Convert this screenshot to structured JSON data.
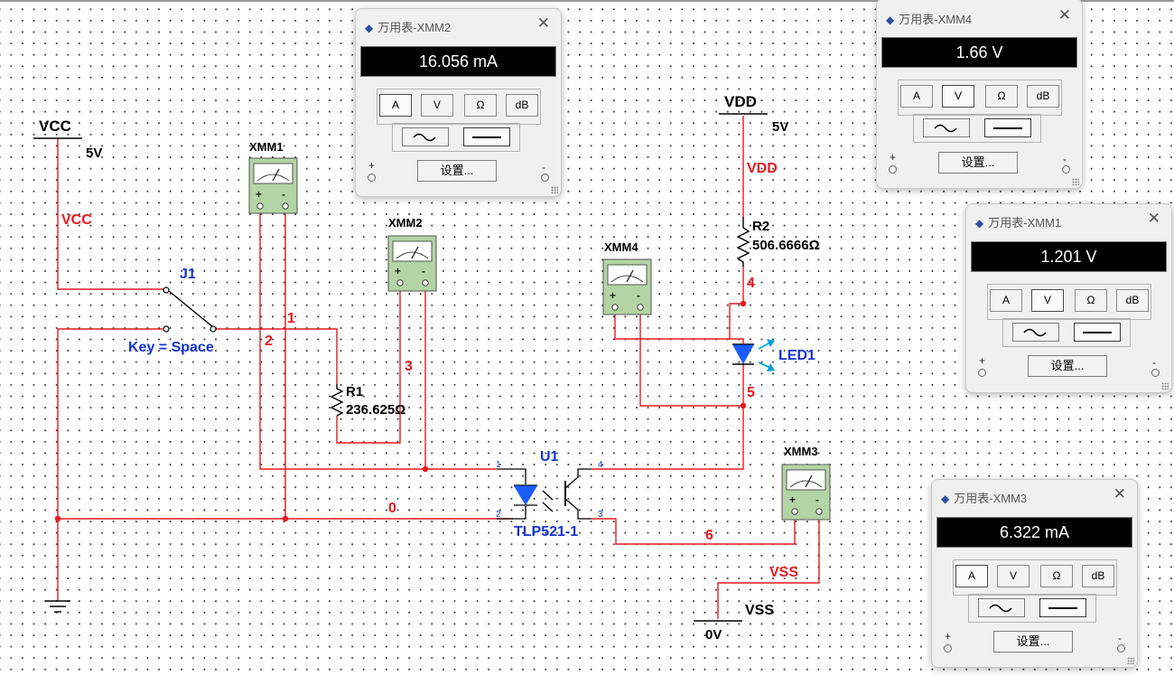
{
  "schematic": {
    "vcc_label": "VCC",
    "vcc_value": "5V",
    "vcc_net": "VCC",
    "vdd_label": "VDD",
    "vdd_value": "5V",
    "vdd_net": "VDD",
    "vss_label": "VSS",
    "vss_value": "0V",
    "vss_net": "VSS",
    "switch_ref": "J1",
    "switch_key": "Key = Space",
    "r1_ref": "R1",
    "r1_value": "236.625Ω",
    "r2_ref": "R2",
    "r2_value": "506.6666Ω",
    "led_ref": "LED1",
    "optocoupler_ref": "U1",
    "optocoupler_part": "TLP521-1",
    "pins": [
      "1",
      "2",
      "3",
      "4"
    ],
    "nets": [
      "0",
      "1",
      "2",
      "3",
      "4",
      "5",
      "6"
    ],
    "meters": [
      "XMM1",
      "XMM2",
      "XMM3",
      "XMM4"
    ]
  },
  "dialogs": [
    {
      "title": "万用表-XMM2",
      "reading": "16.056 mA",
      "active_mode": "A"
    },
    {
      "title": "万用表-XMM4",
      "reading": "1.66 V",
      "active_mode": "V"
    },
    {
      "title": "万用表-XMM1",
      "reading": "1.201 V",
      "active_mode": "V"
    },
    {
      "title": "万用表-XMM3",
      "reading": "6.322 mA",
      "active_mode": "A"
    }
  ],
  "dialog_ui": {
    "modes": [
      "A",
      "V",
      "Ω",
      "dB"
    ],
    "settings_label": "设置...",
    "plus": "+",
    "minus": "-",
    "close": "✕",
    "active_wave": "dc"
  },
  "colors": {
    "wire": "#e8191e",
    "component": "#000000",
    "net_label": "#e8191e",
    "device_label": "#1433d6",
    "led_fill": "#1a5cff",
    "meter_body": "#b3d4a4",
    "display_bg": "#000000"
  }
}
